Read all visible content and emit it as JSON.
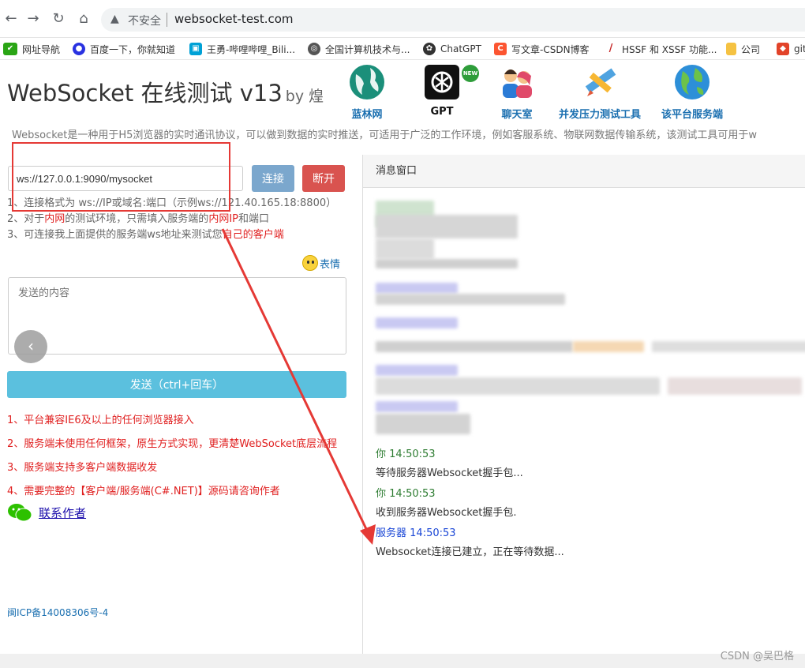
{
  "browser": {
    "back": "←",
    "forward": "→",
    "reload": "↻",
    "home": "⌂",
    "security_label": "不安全",
    "url": "websocket-test.com"
  },
  "bookmarks": [
    {
      "label": "网址导航",
      "icon": "hao-icon",
      "color": "#2aa515"
    },
    {
      "label": "百度一下，你就知道",
      "icon": "baidu-paw-icon",
      "color": "#2932e1"
    },
    {
      "label": "王勇-哔哩哔哩_Bili...",
      "icon": "bilibili-icon",
      "color": "#00a1d6"
    },
    {
      "label": "全国计算机技术与...",
      "icon": "globe-icon",
      "color": "#555555"
    },
    {
      "label": "ChatGPT",
      "icon": "chatgpt-icon",
      "color": "#333333"
    },
    {
      "label": "写文章-CSDN博客",
      "icon": "csdn-icon",
      "color": "#fc5531"
    },
    {
      "label": "HSSF 和 XSSF 功能...",
      "icon": "feather-icon",
      "color": "#c62828"
    },
    {
      "label": "公司",
      "icon": "folder-icon",
      "color": "#f5c242"
    },
    {
      "label": "git",
      "icon": "gitlab-icon",
      "color": "#e24329"
    }
  ],
  "header": {
    "title": "WebSocket 在线测试 v13",
    "by": "by 煌",
    "nav": [
      {
        "label": "蓝林网",
        "icon": "globe-icon"
      },
      {
        "label": "GPT",
        "icon": "chatgpt-logo-icon",
        "badge": "NEW"
      },
      {
        "label": "聊天室",
        "icon": "chat-users-icon"
      },
      {
        "label": "并发压力测试工具",
        "icon": "pencil-ruler-icon"
      },
      {
        "label": "该平台服务端",
        "icon": "server-globe-icon"
      }
    ],
    "intro": "Websocket是一种用于H5浏览器的实时通讯协议，可以做到数据的实时推送，可适用于广泛的工作环境，例如客服系统、物联网数据传输系统，该测试工具可用于w"
  },
  "connect": {
    "url_value": "ws://127.0.0.1:9090/mysocket",
    "connect_label": "连接",
    "disconnect_label": "断开"
  },
  "hints": {
    "line1": "1、连接格式为 ws://IP或域名:端口（示例ws://121.40.165.18:8800）",
    "line2_a": "2、对于",
    "line2_b": "内网",
    "line2_c": "的测试环境，只需填入服务端的",
    "line2_d": "内网IP",
    "line2_e": "和端口",
    "line3_a": "3、可连接我上面提供的服务端ws地址来测试您",
    "line3_b": "自己的客户端"
  },
  "emoji_label": "表情",
  "send": {
    "placeholder": "发送的内容",
    "button_label": "发送（ctrl+回车）"
  },
  "features": [
    "1、平台兼容IE6及以上的任何浏览器接入",
    "2、服务端未使用任何框架，原生方式实现，更清楚WebSocket底层流程",
    "3、服务端支持多客户端数据收发",
    "4、需要完整的【客户端/服务端(C#.NET)】源码请咨询作者"
  ],
  "contact_label": "联系作者",
  "icp": "闽ICP备14008306号-4",
  "messages_panel": {
    "title": "消息窗口",
    "messages": [
      {
        "sender": "你",
        "time": "14:50:53",
        "role": "client",
        "text": "等待服务器Websocket握手包..."
      },
      {
        "sender": "你",
        "time": "14:50:53",
        "role": "client",
        "text": "收到服务器Websocket握手包."
      },
      {
        "sender": "服务器",
        "time": "14:50:53",
        "role": "server",
        "text": "Websocket连接已建立，正在等待数据..."
      }
    ]
  },
  "watermark": "CSDN @吴巴格",
  "colors": {
    "accent_blue": "#1a6fb0",
    "danger_red": "#d9534f",
    "info_cyan": "#5bc0de",
    "connect_blue": "#7ba7cd",
    "annotation_red": "#e53935"
  }
}
